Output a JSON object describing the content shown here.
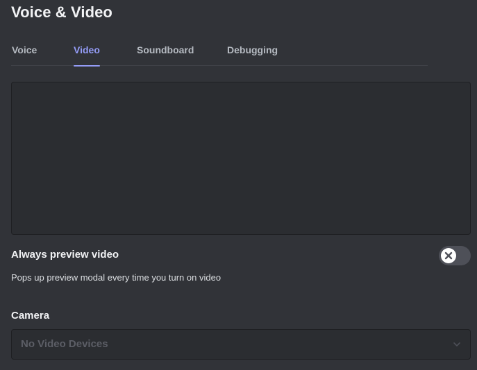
{
  "header": {
    "title": "Voice & Video"
  },
  "tabs": [
    {
      "label": "Voice",
      "active": false
    },
    {
      "label": "Video",
      "active": true
    },
    {
      "label": "Soundboard",
      "active": false
    },
    {
      "label": "Debugging",
      "active": false
    }
  ],
  "preview_setting": {
    "title": "Always preview video",
    "description": "Pops up preview modal every time you turn on video",
    "enabled": false,
    "toggle_icon": "x-icon"
  },
  "camera": {
    "label": "Camera",
    "selected": "No Video Devices",
    "icon": "chevron-down-icon"
  },
  "colors": {
    "background": "#313338",
    "accent": "#949cf7",
    "toggle_off": "#4e5058",
    "preview_bg": "#2b2d31"
  }
}
